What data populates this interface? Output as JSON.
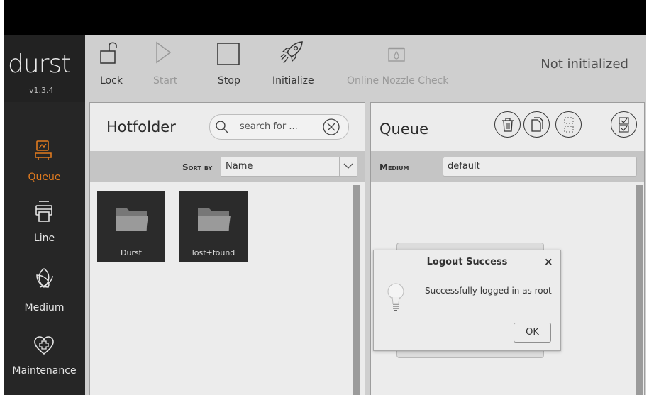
{
  "brand": {
    "logo": "durst",
    "version": "v1.3.4"
  },
  "sidebar": {
    "items": [
      {
        "label": "Queue",
        "icon": "queue-icon",
        "active": true
      },
      {
        "label": "Line",
        "icon": "printer-icon"
      },
      {
        "label": "Medium",
        "icon": "medium-icon"
      },
      {
        "label": "Maintenance",
        "icon": "heart-plus-icon"
      }
    ]
  },
  "toolbar": {
    "lock": "Lock",
    "start": "Start",
    "stop": "Stop",
    "initialize": "Initialize",
    "nozzle": "Online Nozzle Check",
    "status": "Not initialized"
  },
  "hotfolder": {
    "title": "Hotfolder",
    "search_placeholder": "search for ...",
    "sort_label": "Sort by",
    "sort_value": "Name",
    "folders": [
      "Durst",
      "lost+found"
    ]
  },
  "queue": {
    "title": "Queue",
    "medium_label": "Medium",
    "medium_value": "default"
  },
  "dialog": {
    "title": "Logout Success",
    "close": "×",
    "message": "Successfully logged in as root",
    "ok": "OK"
  },
  "colors": {
    "accent": "#e07a1f",
    "sidebar_bg": "#262626",
    "panel_bg": "#ececec",
    "toolbar_bg": "#cfcfcf"
  }
}
